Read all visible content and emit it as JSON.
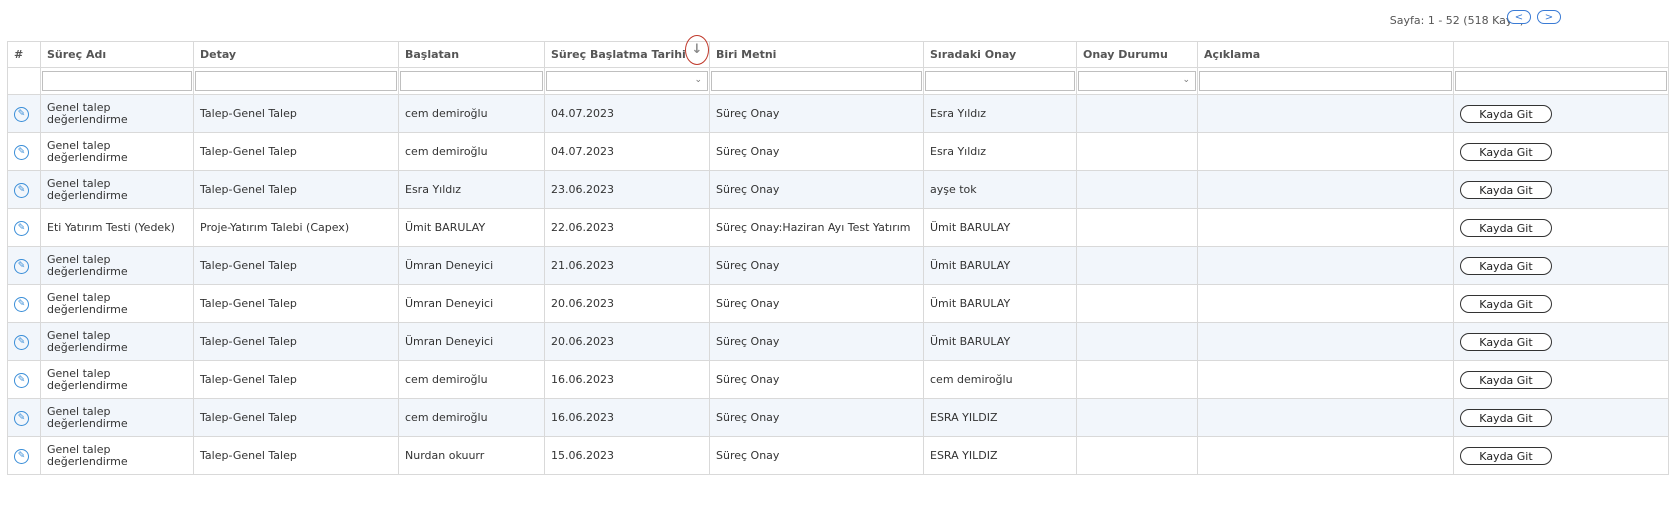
{
  "pager": {
    "text": "Sayfa: 1 - 52 (518 Kayıt)",
    "prev": "<",
    "next": ">"
  },
  "columns": [
    "#",
    "Süreç Adı",
    "Detay",
    "Başlatan",
    "Süreç Başlatma Tarihi",
    "Biri Metni",
    "Sıradaki Onay",
    "Onay Durumu",
    "Açıklama",
    ""
  ],
  "sort_indicator": "↓",
  "rows": [
    {
      "surec": "Genel talep değerlendirme",
      "detay": "Talep-Genel Talep",
      "baslatan": "cem demiroğlu",
      "tarih": "04.07.2023",
      "metin": "Süreç Onay",
      "siradaki": "Esra Yıldız",
      "durum": "",
      "aciklama": "",
      "btn": "Kayda Git"
    },
    {
      "surec": "Genel talep değerlendirme",
      "detay": "Talep-Genel Talep",
      "baslatan": "cem demiroğlu",
      "tarih": "04.07.2023",
      "metin": "Süreç Onay",
      "siradaki": "Esra Yıldız",
      "durum": "",
      "aciklama": "",
      "btn": "Kayda Git"
    },
    {
      "surec": "Genel talep değerlendirme",
      "detay": "Talep-Genel Talep",
      "baslatan": "Esra Yıldız",
      "tarih": "23.06.2023",
      "metin": "Süreç Onay",
      "siradaki": "ayşe tok",
      "durum": "",
      "aciklama": "",
      "btn": "Kayda Git"
    },
    {
      "surec": "Eti Yatırım Testi (Yedek)",
      "detay": "Proje-Yatırım Talebi (Capex)",
      "baslatan": "Ümit BARULAY",
      "tarih": "22.06.2023",
      "metin": "Süreç Onay:Haziran Ayı Test Yatırım",
      "siradaki": "Ümit BARULAY",
      "durum": "",
      "aciklama": "",
      "btn": "Kayda Git"
    },
    {
      "surec": "Genel talep değerlendirme",
      "detay": "Talep-Genel Talep",
      "baslatan": "Ümran Deneyici",
      "tarih": "21.06.2023",
      "metin": "Süreç Onay",
      "siradaki": "Ümit BARULAY",
      "durum": "",
      "aciklama": "",
      "btn": "Kayda Git"
    },
    {
      "surec": "Genel talep değerlendirme",
      "detay": "Talep-Genel Talep",
      "baslatan": "Ümran Deneyici",
      "tarih": "20.06.2023",
      "metin": "Süreç Onay",
      "siradaki": "Ümit BARULAY",
      "durum": "",
      "aciklama": "",
      "btn": "Kayda Git"
    },
    {
      "surec": "Genel talep değerlendirme",
      "detay": "Talep-Genel Talep",
      "baslatan": "Ümran Deneyici",
      "tarih": "20.06.2023",
      "metin": "Süreç Onay",
      "siradaki": "Ümit BARULAY",
      "durum": "",
      "aciklama": "",
      "btn": "Kayda Git"
    },
    {
      "surec": "Genel talep değerlendirme",
      "detay": "Talep-Genel Talep",
      "baslatan": "cem demiroğlu",
      "tarih": "16.06.2023",
      "metin": "Süreç Onay",
      "siradaki": "cem demiroğlu",
      "durum": "",
      "aciklama": "",
      "btn": "Kayda Git"
    },
    {
      "surec": "Genel talep değerlendirme",
      "detay": "Talep-Genel Talep",
      "baslatan": "cem demiroğlu",
      "tarih": "16.06.2023",
      "metin": "Süreç Onay",
      "siradaki": "ESRA YILDIZ",
      "durum": "",
      "aciklama": "",
      "btn": "Kayda Git"
    },
    {
      "surec": "Genel talep değerlendirme",
      "detay": "Talep-Genel Talep",
      "baslatan": "Nurdan okuurr",
      "tarih": "15.06.2023",
      "metin": "Süreç Onay",
      "siradaki": "ESRA YILDIZ",
      "durum": "",
      "aciklama": "",
      "btn": "Kayda Git"
    }
  ]
}
